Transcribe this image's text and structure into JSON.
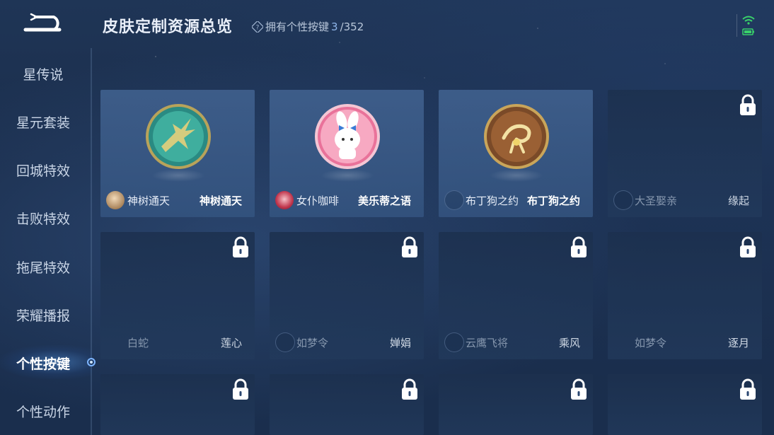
{
  "header": {
    "title": "皮肤定制资源总览",
    "owned_label": "拥有个性按键",
    "owned_count": "3",
    "owned_total": "/352"
  },
  "sidebar": {
    "items": [
      {
        "label": "星传说",
        "active": false
      },
      {
        "label": "星元套装",
        "active": false
      },
      {
        "label": "回城特效",
        "active": false
      },
      {
        "label": "击败特效",
        "active": false
      },
      {
        "label": "拖尾特效",
        "active": false
      },
      {
        "label": "荣耀播报",
        "active": false
      },
      {
        "label": "个性按键",
        "active": true
      },
      {
        "label": "个性动作",
        "active": false
      }
    ]
  },
  "cards": [
    {
      "hero": "神树通天",
      "skin": "神树通天",
      "locked": false,
      "badge": "leaf-badge-icon",
      "avatar": true
    },
    {
      "hero": "女仆咖啡",
      "skin": "美乐蒂之语",
      "locked": false,
      "badge": "melody-badge-icon",
      "avatar": true
    },
    {
      "hero": "布丁狗之约",
      "skin": "布丁狗之约",
      "locked": false,
      "badge": "bow-badge-icon",
      "avatar": false
    },
    {
      "hero": "大圣娶亲",
      "skin": "缘起",
      "locked": true,
      "avatar": false
    },
    {
      "hero": "白蛇",
      "skin": "莲心",
      "locked": true,
      "avatar": false
    },
    {
      "hero": "如梦令",
      "skin": "婵娟",
      "locked": true,
      "avatar": false
    },
    {
      "hero": "云鹰飞将",
      "skin": "乘风",
      "locked": true,
      "avatar": false
    },
    {
      "hero": "如梦令",
      "skin": "逐月",
      "locked": true,
      "avatar": false
    },
    {
      "hero": "",
      "skin": "",
      "locked": true
    },
    {
      "hero": "",
      "skin": "",
      "locked": true
    },
    {
      "hero": "",
      "skin": "",
      "locked": true
    },
    {
      "hero": "",
      "skin": "",
      "locked": true
    }
  ],
  "colors": {
    "background": "#1f3556",
    "accent": "#7fb6ff",
    "owned_count": "#8fb6ea"
  }
}
